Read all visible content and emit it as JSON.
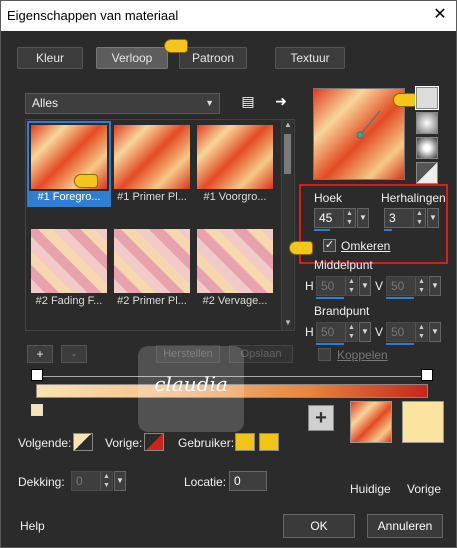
{
  "window": {
    "title": "Eigenschappen van materiaal"
  },
  "tabs": [
    {
      "label": "Kleur"
    },
    {
      "label": "Verloop"
    },
    {
      "label": "Patroon"
    },
    {
      "label": "Textuur"
    }
  ],
  "gallery": {
    "filter": "Alles",
    "items": [
      {
        "caption": "#1 Foregro...",
        "style": "g1"
      },
      {
        "caption": "#1 Primer Pl...",
        "style": "g1"
      },
      {
        "caption": "#1 Voorgro...",
        "style": "g1"
      },
      {
        "caption": "#2 Fading F...",
        "style": "g2"
      },
      {
        "caption": "#2 Primer Pl...",
        "style": "g2"
      },
      {
        "caption": "#2 Vervage...",
        "style": "g2"
      }
    ]
  },
  "buttons": {
    "plus": "+",
    "minus": "-",
    "herstellen": "Herstellen",
    "opslaan": "Opslaan"
  },
  "settings": {
    "hoek_label": "Hoek",
    "hoek_value": "45",
    "herhalingen_label": "Herhalingen",
    "herhalingen_value": "3",
    "omkeren_label": "Omkeren",
    "omkeren_checked": "✓",
    "middelpunt_label": "Middelpunt",
    "h_label": "H",
    "v_label": "V",
    "middelpunt_h": "50",
    "middelpunt_v": "50",
    "brandpunt_label": "Brandpunt",
    "brandpunt_h": "50",
    "brandpunt_v": "50",
    "koppelen_label": "Koppelen"
  },
  "watermark": {
    "text": "claudia"
  },
  "color_row": {
    "volgende_label": "Volgende:",
    "vorige_label": "Vorige:",
    "gebruiker_label": "Gebruiker:",
    "dekking_label": "Dekking:",
    "dekking_value": "0",
    "locatie_label": "Locatie:",
    "locatie_value": "0",
    "huidige_label": "Huidige",
    "vorige_big_label": "Vorige"
  },
  "footer": {
    "help": "Help",
    "ok": "OK",
    "annuleren": "Annuleren"
  },
  "colors": {
    "accent": "#2e7fd4",
    "highlight": "#e01a1a",
    "foreground": "#c7261c",
    "background": "#fbe3b1",
    "user": "#f2c418"
  }
}
